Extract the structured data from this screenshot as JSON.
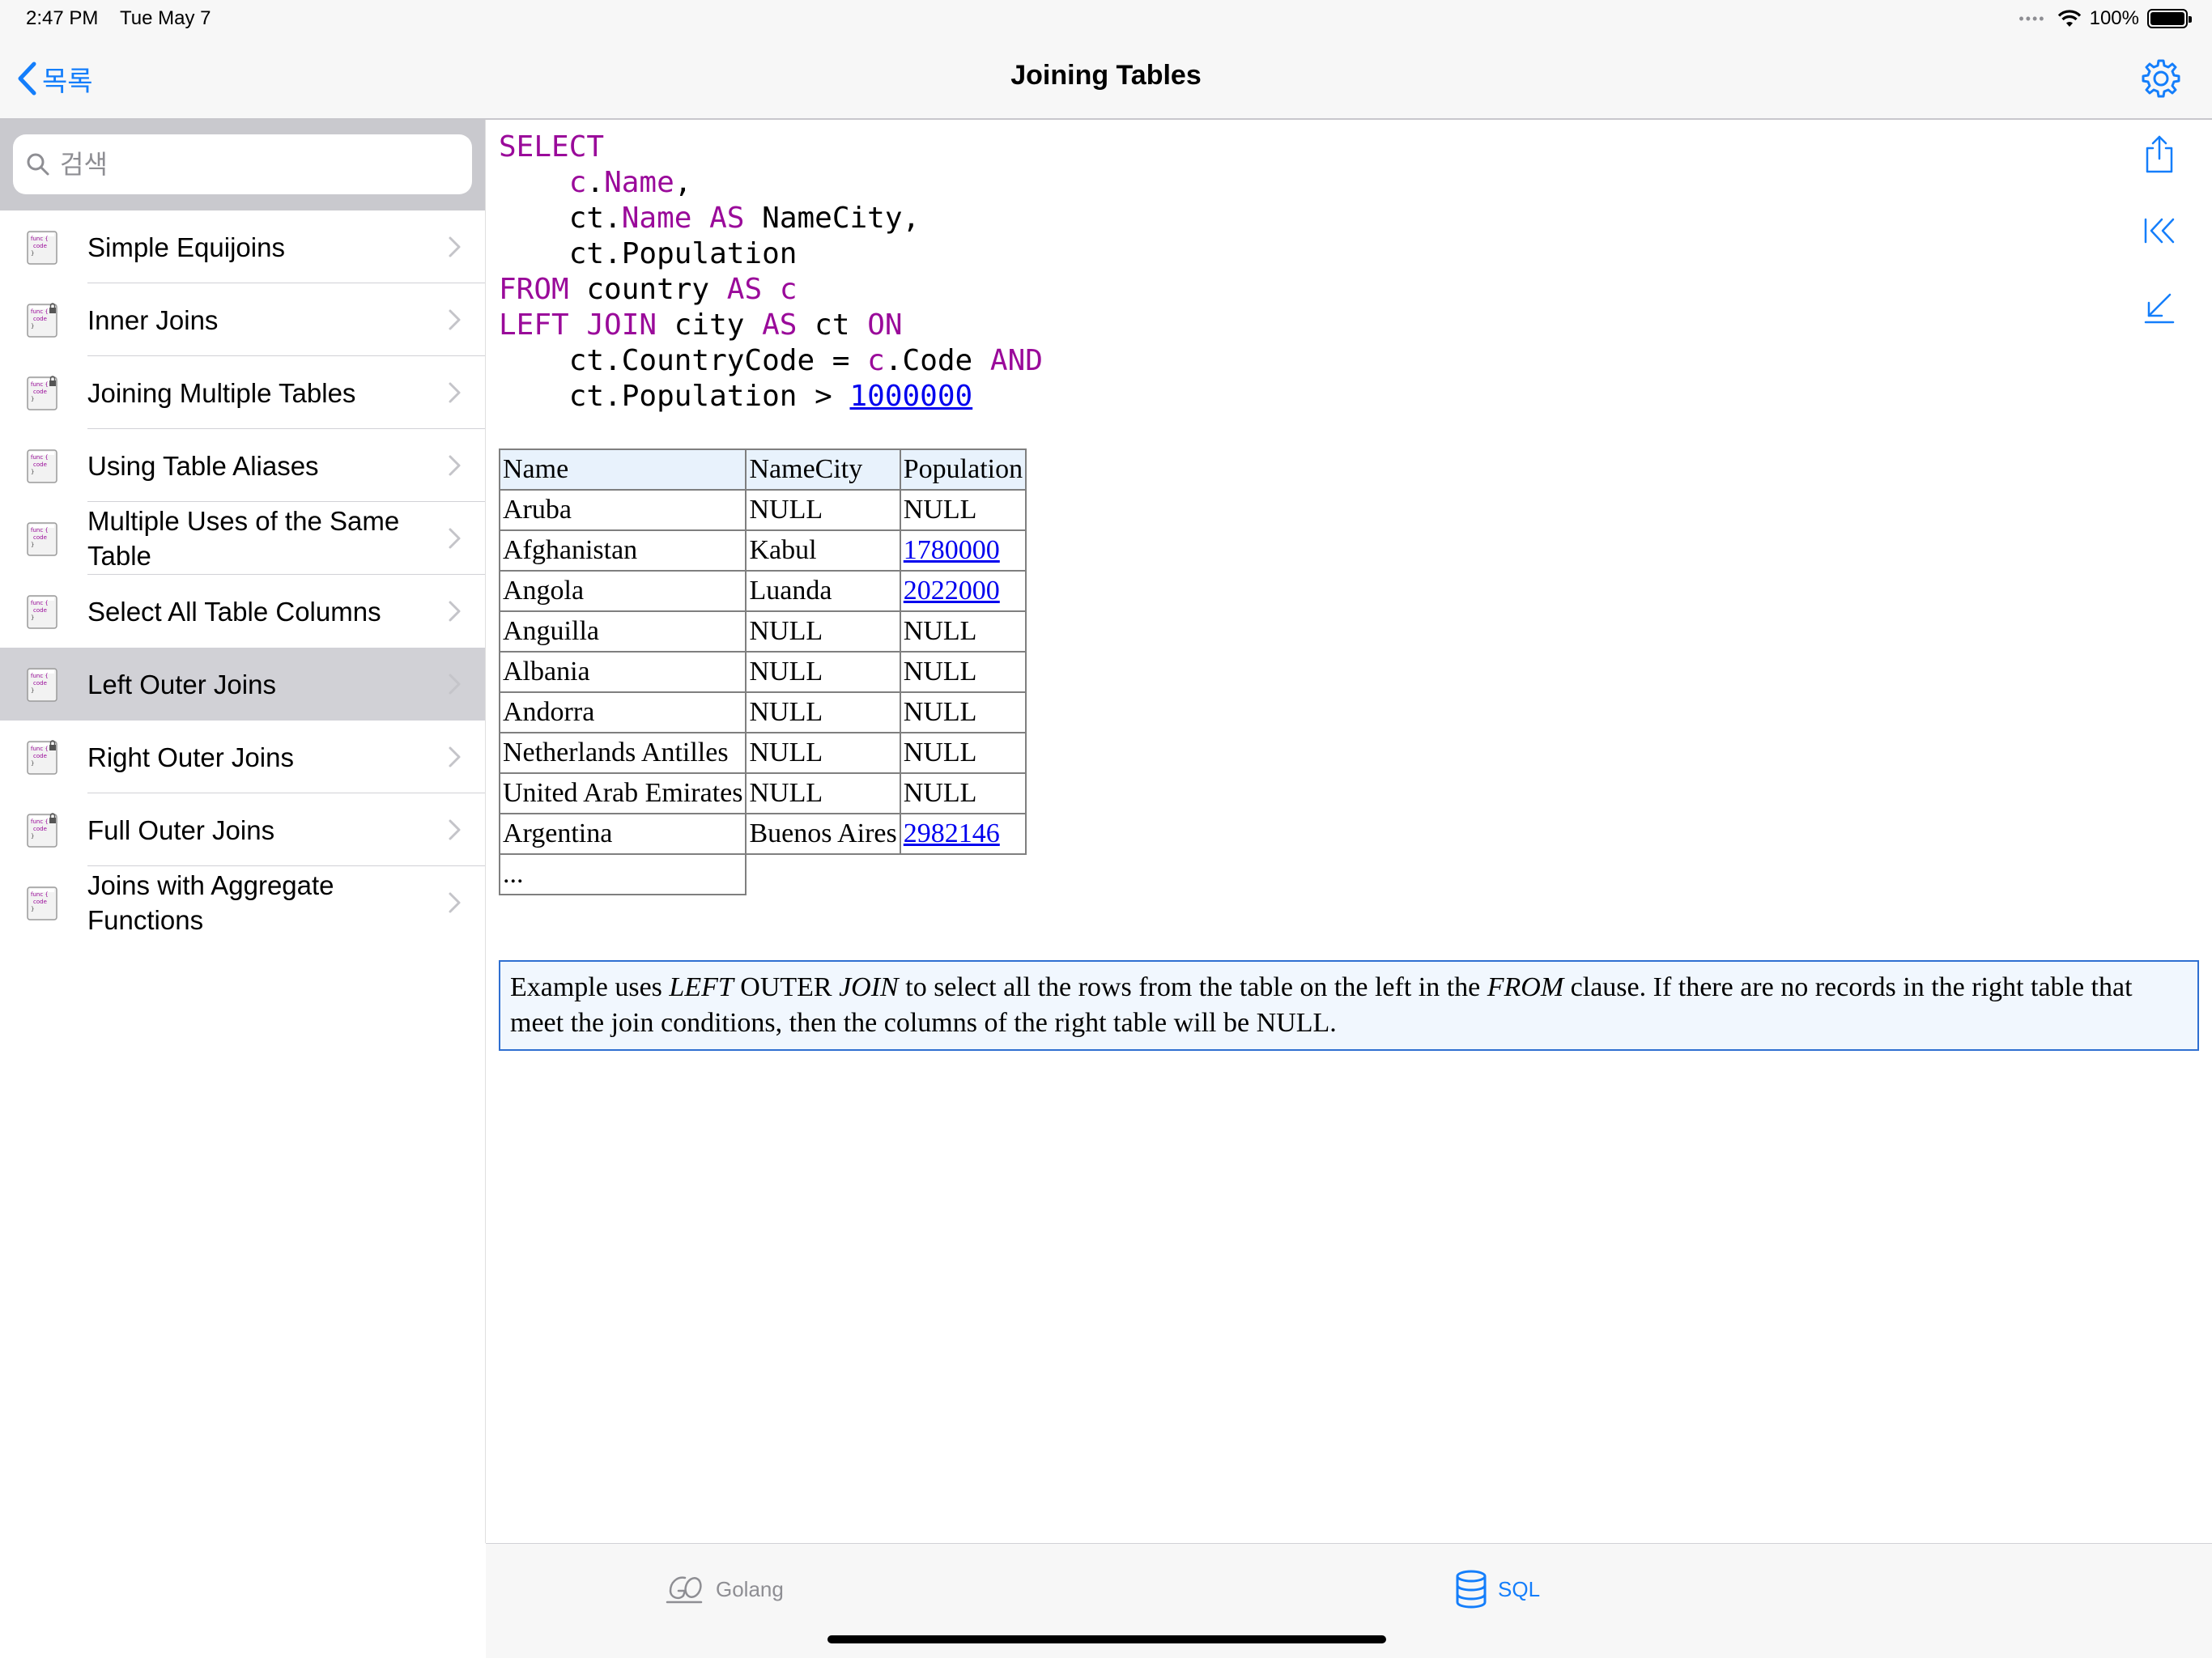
{
  "status_bar": {
    "time": "2:47 PM",
    "date": "Tue May 7",
    "battery_text": "100%",
    "icons": [
      "signal-dots-icon",
      "wifi-icon",
      "battery-icon"
    ]
  },
  "nav": {
    "back_label": "목록",
    "title": "Joining Tables",
    "settings_icon": "gear-icon",
    "accent_color": "#147efb"
  },
  "search": {
    "placeholder": "검색",
    "value": ""
  },
  "sidebar": {
    "items": [
      {
        "label": "Simple Equijoins",
        "locked": false,
        "selected": false
      },
      {
        "label": "Inner Joins",
        "locked": true,
        "selected": false
      },
      {
        "label": "Joining Multiple Tables",
        "locked": true,
        "selected": false
      },
      {
        "label": "Using Table Aliases",
        "locked": false,
        "selected": false
      },
      {
        "label": "Multiple Uses of the Same Table",
        "locked": false,
        "selected": false
      },
      {
        "label": "Select All Table Columns",
        "locked": false,
        "selected": false
      },
      {
        "label": "Left Outer Joins",
        "locked": false,
        "selected": true
      },
      {
        "label": "Right Outer Joins",
        "locked": true,
        "selected": false
      },
      {
        "label": "Full Outer Joins",
        "locked": true,
        "selected": false
      },
      {
        "label": "Joins with Aggregate Functions",
        "locked": false,
        "selected": false
      }
    ],
    "icon_text": [
      "func {",
      "code",
      "}"
    ]
  },
  "code": {
    "lines": [
      [
        {
          "t": "SELECT",
          "k": true
        }
      ],
      [
        {
          "t": "    ",
          "k": false
        },
        {
          "t": "c",
          "k": true
        },
        {
          "t": ".",
          "k": false
        },
        {
          "t": "Name",
          "k": true
        },
        {
          "t": ",",
          "k": false
        }
      ],
      [
        {
          "t": "    ct.",
          "k": false
        },
        {
          "t": "Name",
          "k": true
        },
        {
          "t": " ",
          "k": false
        },
        {
          "t": "AS",
          "k": true
        },
        {
          "t": " NameCity,",
          "k": false
        }
      ],
      [
        {
          "t": "    ct.Population",
          "k": false
        }
      ],
      [
        {
          "t": "FROM",
          "k": true
        },
        {
          "t": " country ",
          "k": false
        },
        {
          "t": "AS",
          "k": true
        },
        {
          "t": " ",
          "k": false
        },
        {
          "t": "c",
          "k": true
        }
      ],
      [
        {
          "t": "LEFT JOIN",
          "k": true
        },
        {
          "t": " city ",
          "k": false
        },
        {
          "t": "AS",
          "k": true
        },
        {
          "t": " ct ",
          "k": false
        },
        {
          "t": "ON",
          "k": true
        }
      ],
      [
        {
          "t": "    ct.CountryCode = ",
          "k": false
        },
        {
          "t": "c",
          "k": true
        },
        {
          "t": ".Code ",
          "k": false
        },
        {
          "t": "AND",
          "k": true
        }
      ],
      [
        {
          "t": "    ct.Population > ",
          "k": false
        },
        {
          "t": "1000000",
          "k": false,
          "link": true
        }
      ]
    ],
    "keyword_color": "#9a0a9a"
  },
  "result_table": {
    "columns": [
      "Name",
      "NameCity",
      "Population"
    ],
    "rows": [
      [
        {
          "v": "Aruba"
        },
        {
          "v": "NULL"
        },
        {
          "v": "NULL"
        }
      ],
      [
        {
          "v": "Afghanistan"
        },
        {
          "v": "Kabul"
        },
        {
          "v": "1780000",
          "link": true
        }
      ],
      [
        {
          "v": "Angola"
        },
        {
          "v": "Luanda"
        },
        {
          "v": "2022000",
          "link": true
        }
      ],
      [
        {
          "v": "Anguilla"
        },
        {
          "v": "NULL"
        },
        {
          "v": "NULL"
        }
      ],
      [
        {
          "v": "Albania"
        },
        {
          "v": "NULL"
        },
        {
          "v": "NULL"
        }
      ],
      [
        {
          "v": "Andorra"
        },
        {
          "v": "NULL"
        },
        {
          "v": "NULL"
        }
      ],
      [
        {
          "v": "Netherlands Antilles"
        },
        {
          "v": "NULL"
        },
        {
          "v": "NULL"
        }
      ],
      [
        {
          "v": "United Arab Emirates"
        },
        {
          "v": "NULL"
        },
        {
          "v": "NULL"
        }
      ],
      [
        {
          "v": "Argentina"
        },
        {
          "v": "Buenos Aires"
        },
        {
          "v": "2982146",
          "link": true
        }
      ]
    ],
    "ellipsis": "..."
  },
  "note": {
    "segments": [
      {
        "t": "Example uses ",
        "i": false
      },
      {
        "t": "LEFT",
        "i": true
      },
      {
        "t": " OUTER ",
        "i": false
      },
      {
        "t": "JOIN",
        "i": true
      },
      {
        "t": " to select all the rows from the table on the left in the ",
        "i": false
      },
      {
        "t": "FROM",
        "i": true
      },
      {
        "t": " clause. If there are no records in the right table that meet the join conditions, then the columns of the right table will be NULL.",
        "i": false
      }
    ]
  },
  "side_tools": [
    "share-icon",
    "first-page-icon",
    "scroll-to-bottom-icon"
  ],
  "tabs": {
    "golang": {
      "label": "Golang",
      "icon": "golang-icon",
      "active": false
    },
    "sql": {
      "label": "SQL",
      "icon": "database-icon",
      "active": true
    }
  }
}
